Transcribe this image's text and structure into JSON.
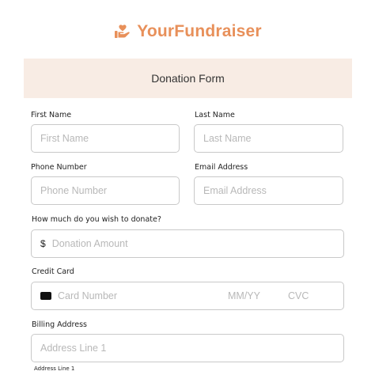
{
  "brand": {
    "name": "YourFundraiser",
    "accent": "#e8905a",
    "icon": "heart-hand-icon"
  },
  "form": {
    "title": "Donation Form",
    "first_name": {
      "label": "First Name",
      "placeholder": "First Name"
    },
    "last_name": {
      "label": "Last Name",
      "placeholder": "Last Name"
    },
    "phone": {
      "label": "Phone Number",
      "placeholder": "Phone Number"
    },
    "email": {
      "label": "Email Address",
      "placeholder": "Email Address"
    },
    "donation": {
      "label": "How much do you wish to donate?",
      "currency": "$",
      "placeholder": "Donation Amount"
    },
    "credit_card": {
      "label": "Credit Card",
      "card_icon": "credit-card-icon",
      "number_placeholder": "Card Number",
      "expiry_placeholder": "MM/YY",
      "cvc_placeholder": "CVC"
    },
    "billing": {
      "label": "Billing Address",
      "line1_placeholder": "Address Line 1",
      "line1_sublabel": "Address Line 1"
    }
  },
  "colors": {
    "header_bg": "#f8ece4",
    "border": "#c9c9c9",
    "placeholder": "#b8b8b8"
  }
}
